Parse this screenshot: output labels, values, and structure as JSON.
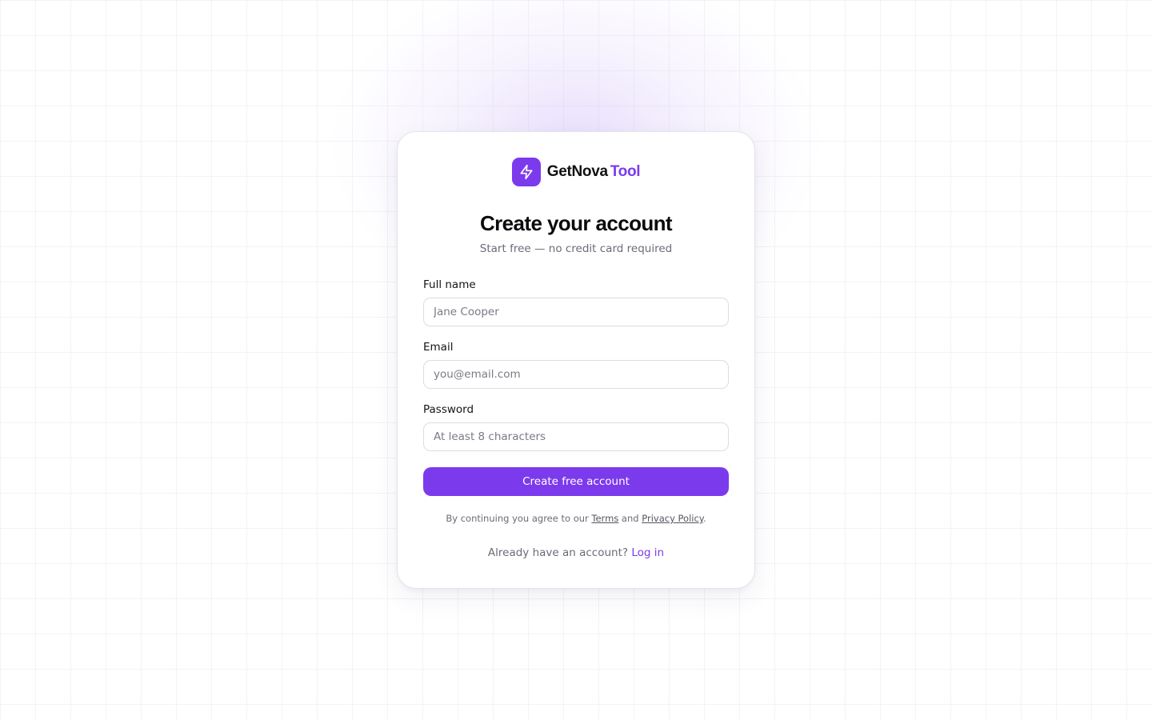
{
  "brand": {
    "name_primary": "GetNova",
    "name_accent": "Tool",
    "logo_icon": "lightning-bolt-icon",
    "accent_color": "#7c3aed"
  },
  "heading": {
    "title": "Create your account",
    "subtitle": "Start free — no credit card required"
  },
  "form": {
    "full_name": {
      "label": "Full name",
      "placeholder": "Jane Cooper",
      "value": ""
    },
    "email": {
      "label": "Email",
      "placeholder": "you@email.com",
      "value": ""
    },
    "password": {
      "label": "Password",
      "placeholder": "At least 8 characters",
      "value": ""
    },
    "submit_label": "Create free account"
  },
  "legal": {
    "prefix": "By continuing you agree to our ",
    "terms": "Terms",
    "middle": " and ",
    "privacy": "Privacy Policy",
    "suffix": "."
  },
  "login": {
    "prompt": "Already have an account? ",
    "link": "Log in"
  }
}
